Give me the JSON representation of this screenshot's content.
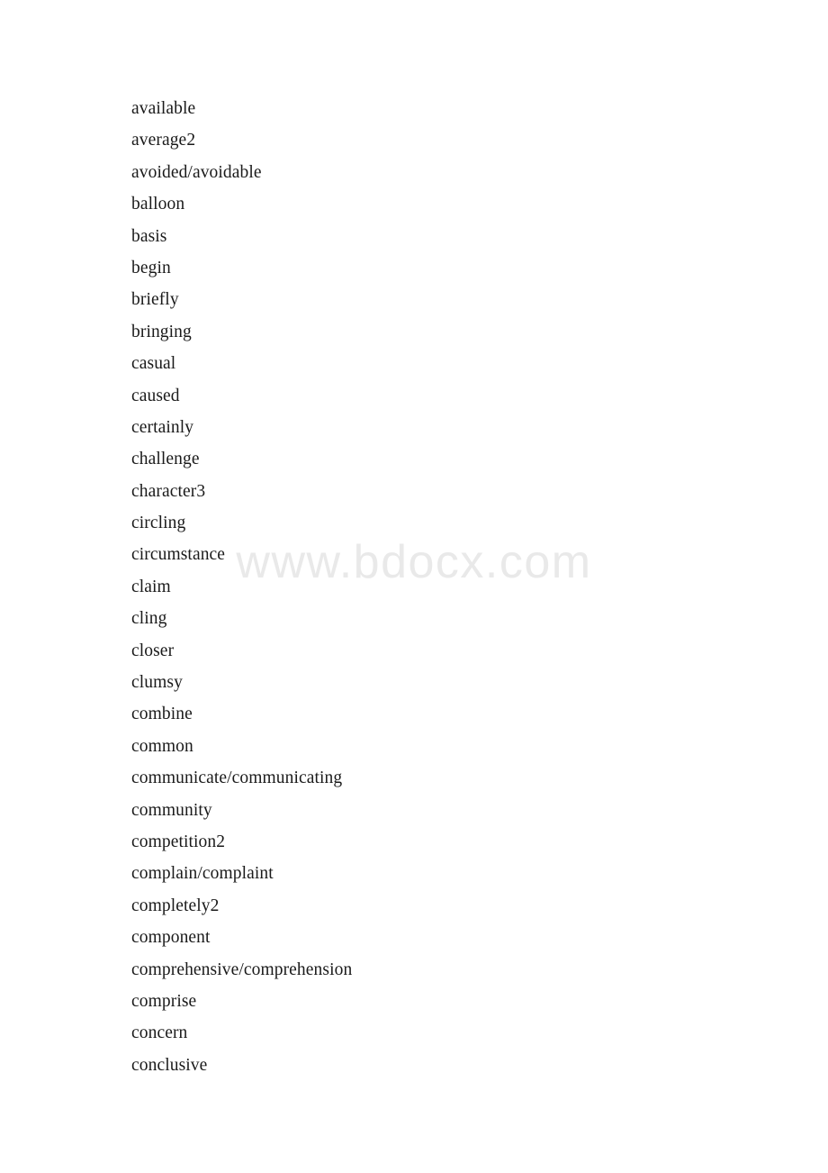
{
  "document": {
    "background_color": "#ffffff",
    "text_color": "#1a1a1a"
  },
  "watermark": {
    "text": "www.bdocx.com",
    "color": "#e9e9e9"
  },
  "word_list": {
    "items": [
      "available",
      "average2",
      "avoided/avoidable",
      "balloon",
      "basis",
      "begin",
      "briefly",
      "bringing",
      "casual",
      "caused",
      "certainly",
      "challenge",
      "character3",
      "circling",
      "circumstance",
      "claim",
      "cling",
      "closer",
      "clumsy",
      "combine",
      "common",
      "communicate/communicating",
      "community",
      "competition2",
      "complain/complaint",
      "completely2",
      "component",
      "comprehensive/comprehension",
      "comprise",
      "concern",
      "conclusive"
    ]
  }
}
